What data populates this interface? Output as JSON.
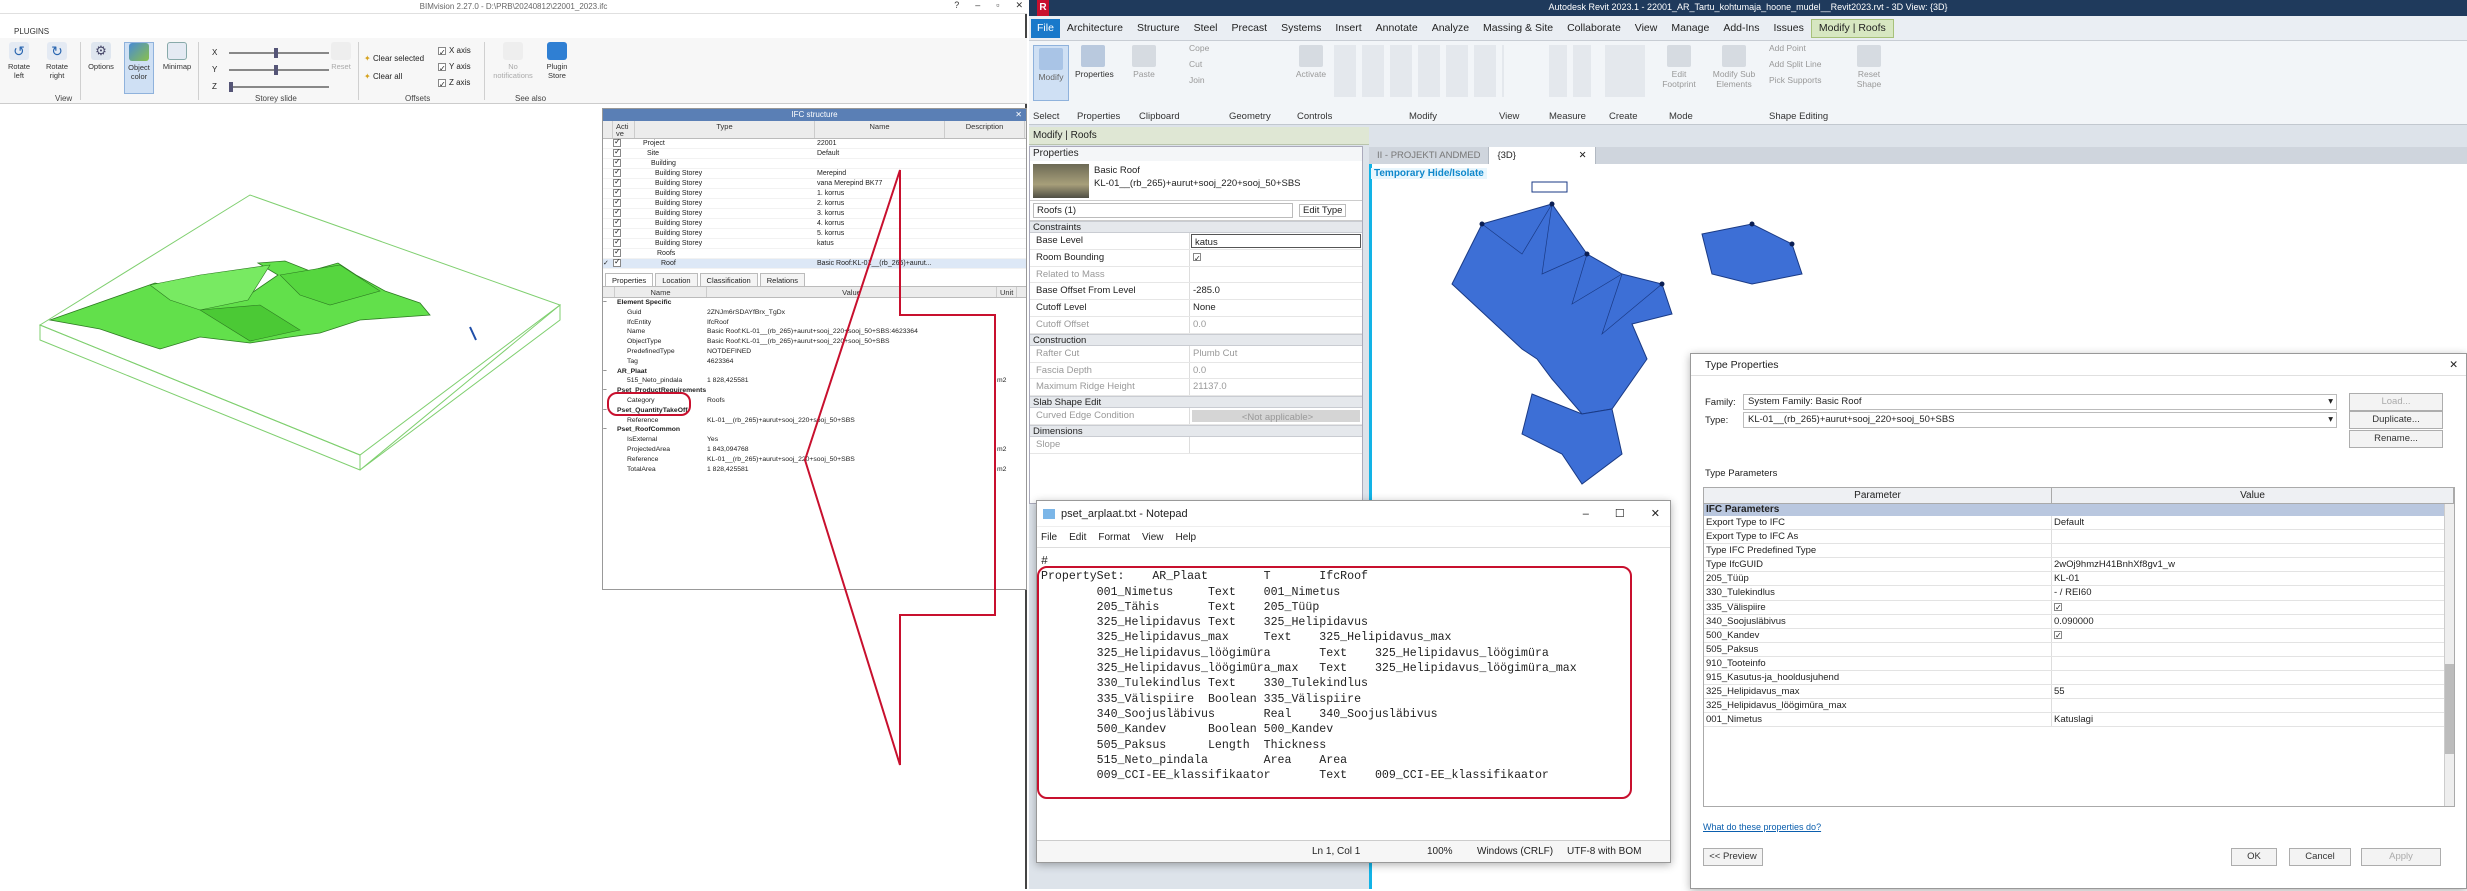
{
  "bim": {
    "title": "BIMvision 2.27.0 - D:\\PRB\\20240812\\22001_2023.ifc",
    "tab_plugins": "PLUGINS",
    "buttons": {
      "rotate_left": "Rotate left",
      "rotate_right": "Rotate right",
      "options": "Options",
      "object_color": "Object color",
      "minimap": "Minimap",
      "reset": "Reset",
      "clear_selected": "Clear selected",
      "clear_all": "Clear all",
      "x_axis": "X axis",
      "y_axis": "Y axis",
      "z_axis": "Z axis",
      "no_notifications": "No notifications",
      "plugin_store": "Plugin Store"
    },
    "slider_labels": [
      "X",
      "Y",
      "Z"
    ],
    "groups": {
      "view": "View",
      "storey_slide": "Storey slide",
      "offsets": "Offsets",
      "see_also": "See also"
    },
    "ifc_structure": {
      "title": "IFC structure",
      "columns": [
        "Acti ve",
        "Type",
        "Name",
        "Description"
      ],
      "rows": [
        {
          "type": "Project",
          "name": "22001"
        },
        {
          "type": "Site",
          "name": "Default"
        },
        {
          "type": "Building",
          "name": ""
        },
        {
          "type": "Building Storey",
          "name": "Merepind"
        },
        {
          "type": "Building Storey",
          "name": "vana Merepind BK77"
        },
        {
          "type": "Building Storey",
          "name": "1. korrus"
        },
        {
          "type": "Building Storey",
          "name": "2. korrus"
        },
        {
          "type": "Building Storey",
          "name": "3. korrus"
        },
        {
          "type": "Building Storey",
          "name": "4. korrus"
        },
        {
          "type": "Building Storey",
          "name": "5. korrus"
        },
        {
          "type": "Building Storey",
          "name": "katus"
        },
        {
          "type": "Roofs",
          "name": ""
        },
        {
          "type": "Roof",
          "name": "Basic Roof:KL-01__(rb_265)+aurut..."
        }
      ]
    },
    "prop_tabs": [
      "Properties",
      "Location",
      "Classification",
      "Relations"
    ],
    "prop_columns": [
      "Name",
      "Value",
      "Unit"
    ],
    "prop_rows": [
      {
        "group": true,
        "name": "Element Specific"
      },
      {
        "name": "Guid",
        "value": "2ZNJm6rSDAYfBrx_TgDx"
      },
      {
        "name": "IfcEntity",
        "value": "IfcRoof"
      },
      {
        "name": "Name",
        "value": "Basic Roof:KL-01__(rb_265)+aurut+sooj_220+sooj_50+SBS:4623364"
      },
      {
        "name": "ObjectType",
        "value": "Basic Roof:KL-01__(rb_265)+aurut+sooj_220+sooj_50+SBS"
      },
      {
        "name": "PredefinedType",
        "value": "NOTDEFINED"
      },
      {
        "name": "Tag",
        "value": "4623364"
      },
      {
        "group": true,
        "name": "AR_Plaat"
      },
      {
        "name": "515_Neto_pindala",
        "value": "1 828,425581",
        "unit": "m2"
      },
      {
        "group": true,
        "name": "Pset_ProductRequirements"
      },
      {
        "name": "Category",
        "value": "Roofs"
      },
      {
        "group": true,
        "name": "Pset_QuantityTakeOff"
      },
      {
        "name": "Reference",
        "value": "KL-01__(rb_265)+aurut+sooj_220+sooj_50+SBS"
      },
      {
        "group": true,
        "name": "Pset_RoofCommon"
      },
      {
        "name": "IsExternal",
        "value": "Yes"
      },
      {
        "name": "ProjectedArea",
        "value": "1 843,094768",
        "unit": "m2"
      },
      {
        "name": "Reference",
        "value": "KL-01__(rb_265)+aurut+sooj_220+sooj_50+SBS"
      },
      {
        "name": "TotalArea",
        "value": "1 828,425581",
        "unit": "m2"
      }
    ]
  },
  "revit": {
    "title": "Autodesk Revit 2023.1 - 22001_AR_Tartu_kohtumaja_hoone_mudel__Revit2023.rvt - 3D View: {3D}",
    "menu": [
      "File",
      "Architecture",
      "Structure",
      "Steel",
      "Precast",
      "Systems",
      "Insert",
      "Annotate",
      "Analyze",
      "Massing & Site",
      "Collaborate",
      "View",
      "Manage",
      "Add-Ins",
      "Issues",
      "Modify | Roofs"
    ],
    "ribbon_groups": [
      "Select",
      "Properties",
      "Clipboard",
      "Geometry",
      "Controls",
      "Modify",
      "View",
      "Measure",
      "Create",
      "Mode",
      "Shape Editing"
    ],
    "ribbon_buttons": {
      "modify": "Modify",
      "properties": "Properties",
      "paste": "Paste",
      "cope": "Cope",
      "cut": "Cut",
      "join": "Join",
      "activate": "Activate",
      "edit_footprint": "Edit Footprint",
      "modify_sub": "Modify Sub Elements",
      "add_point": "Add Point",
      "add_split_line": "Add Split Line",
      "pick_supports": "Pick Supports",
      "reset_shape": "Reset Shape"
    },
    "context_label": "Modify | Roofs",
    "props_header": "Properties",
    "type_name_1": "Basic Roof",
    "type_name_2": "KL-01__(rb_265)+aurut+sooj_220+sooj_50+SBS",
    "instance": "Roofs (1)",
    "edit_type": "Edit Type",
    "sections": [
      {
        "title": "Constraints",
        "rows": [
          {
            "k": "Base Level",
            "v": "katus"
          },
          {
            "k": "Room Bounding",
            "v": ""
          },
          {
            "k": "Related to Mass",
            "v": "",
            "dim": true
          },
          {
            "k": "Base Offset From Level",
            "v": "-285.0"
          },
          {
            "k": "Cutoff Level",
            "v": "None"
          },
          {
            "k": "Cutoff Offset",
            "v": "0.0",
            "dim": true
          }
        ]
      },
      {
        "title": "Construction",
        "rows": [
          {
            "k": "Rafter Cut",
            "v": "Plumb Cut",
            "dim": true
          },
          {
            "k": "Fascia Depth",
            "v": "0.0",
            "dim": true
          },
          {
            "k": "Maximum Ridge Height",
            "v": "21137.0",
            "dim": true
          }
        ]
      },
      {
        "title": "Slab Shape Edit",
        "rows": [
          {
            "k": "Curved Edge Condition",
            "v": "<Not applicable>",
            "dim": true
          }
        ]
      },
      {
        "title": "Dimensions",
        "rows": [
          {
            "k": "Slope",
            "v": "",
            "dim": true
          }
        ]
      }
    ],
    "view_tabs": [
      "II - PROJEKTI ANDMED",
      "{3D}"
    ],
    "temp_isolate": "Temporary Hide/Isolate",
    "notepad": {
      "title": "pset_arplaat.txt - Notepad",
      "menu": [
        "File",
        "Edit",
        "Format",
        "View",
        "Help"
      ],
      "lines": [
        "#",
        "PropertySet:    AR_Plaat        T       IfcRoof",
        "        001_Nimetus     Text    001_Nimetus",
        "        205_Tähis       Text    205_Tüüp",
        "        325_Helipidavus Text    325_Helipidavus",
        "        325_Helipidavus_max     Text    325_Helipidavus_max",
        "        325_Helipidavus_löögimüra       Text    325_Helipidavus_löögimüra",
        "        325_Helipidavus_löögimüra_max   Text    325_Helipidavus_löögimüra_max",
        "        330_Tulekindlus Text    330_Tulekindlus",
        "        335_Välispiire  Boolean 335_Välispiire",
        "        340_Soojusläbivus       Real    340_Soojusläbivus",
        "        500_Kandev      Boolean 500_Kandev",
        "        505_Paksus      Length  Thickness",
        "        515_Neto_pindala        Area    Area",
        "        009_CCI-EE_klassifikaator       Text    009_CCI-EE_klassifikaator"
      ],
      "status": {
        "pos": "Ln 1, Col 1",
        "zoom": "100%",
        "eol": "Windows (CRLF)",
        "enc": "UTF-8 with BOM"
      }
    },
    "type_props": {
      "title": "Type Properties",
      "family_label": "Family:",
      "family_value": "System Family: Basic Roof",
      "type_label": "Type:",
      "type_value": "KL-01__(rb_265)+aurut+sooj_220+sooj_50+SBS",
      "load": "Load...",
      "duplicate": "Duplicate...",
      "rename": "Rename...",
      "params_label": "Type Parameters",
      "col_param": "Parameter",
      "col_value": "Value",
      "section": "IFC Parameters",
      "rows": [
        {
          "k": "Export Type to IFC",
          "v": "Default"
        },
        {
          "k": "Export Type to IFC As",
          "v": ""
        },
        {
          "k": "Type IFC Predefined Type",
          "v": ""
        },
        {
          "k": "Type IfcGUID",
          "v": "2wOj9hmzH41BnhXf8gv1_w"
        },
        {
          "k": "205_Tüüp",
          "v": "KL-01"
        },
        {
          "k": "330_Tulekindlus",
          "v": "- / REI60"
        },
        {
          "k": "335_Välispiire",
          "v": "",
          "check": true
        },
        {
          "k": "340_Soojusläbivus",
          "v": "0.090000"
        },
        {
          "k": "500_Kandev",
          "v": "",
          "check": true
        },
        {
          "k": "505_Paksus",
          "v": ""
        },
        {
          "k": "910_Tooteinfo",
          "v": ""
        },
        {
          "k": "915_Kasutus-ja_hooldusjuhend",
          "v": ""
        },
        {
          "k": "325_Helipidavus_max",
          "v": "55"
        },
        {
          "k": "325_Helipidavus_löögimüra_max",
          "v": ""
        },
        {
          "k": "001_Nimetus",
          "v": "Katuslagi"
        }
      ],
      "help_link": "What do these properties do?",
      "preview": "<< Preview",
      "ok": "OK",
      "cancel": "Cancel",
      "apply": "Apply"
    }
  }
}
